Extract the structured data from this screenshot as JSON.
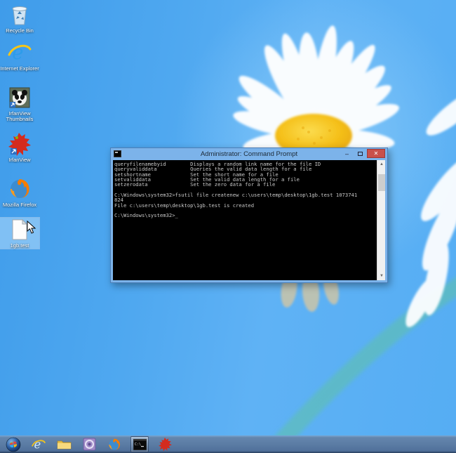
{
  "wallpaper": {
    "base_color": "#4FA8F0",
    "petal_color": "#FFFFFF",
    "flower_center_color": "#F5C01A",
    "stem_color": "#5EC0B0"
  },
  "desktop": {
    "icons": [
      {
        "label": "Recycle Bin",
        "selected": false
      },
      {
        "label": "Internet Explorer",
        "selected": false
      },
      {
        "label": "IrfanView Thumbnails",
        "selected": false
      },
      {
        "label": "IrfanView",
        "selected": false
      },
      {
        "label": "Mozilla Firefox",
        "selected": false
      },
      {
        "label": "1gb.test",
        "selected": true
      }
    ]
  },
  "window": {
    "title": "Administrator: Command Prompt",
    "controls": {
      "minimize": "–",
      "close": "✕"
    },
    "scrollbar": {
      "up_arrow": "▲",
      "down_arrow": "▼"
    },
    "console_text": "queryfilenamebyid        Displays a random link name for the file ID\nqueryvaliddata           Queries the valid data length for a file\nsetshortname             Set the short name for a file\nsetvaliddata             Set the valid data length for a file\nsetzerodata              Set the zero data for a file\n\nC:\\Windows\\system32>fsutil file createnew c:\\users\\temp\\desktop\\1gb.test 1073741\n824\nFile c:\\users\\temp\\desktop\\1gb.test is created\n\nC:\\Windows\\system32>_"
  },
  "taskbar": {
    "items": [
      {
        "name": "start"
      },
      {
        "name": "internet-explorer"
      },
      {
        "name": "file-explorer"
      },
      {
        "name": "purple-app"
      },
      {
        "name": "firefox"
      },
      {
        "name": "command-prompt",
        "active": true
      },
      {
        "name": "irfanview"
      }
    ]
  }
}
